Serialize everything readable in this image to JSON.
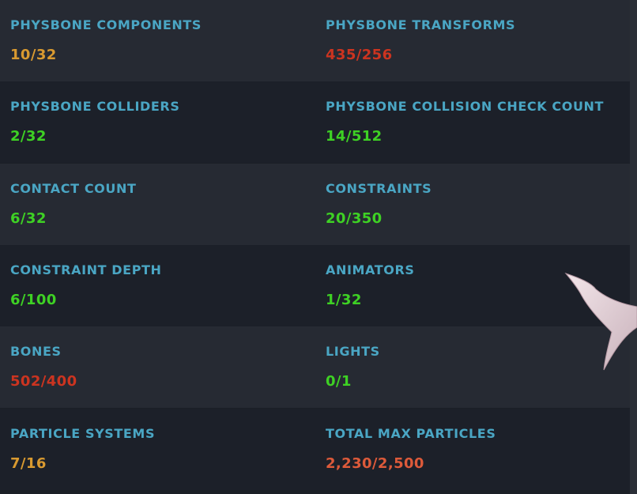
{
  "stats": [
    {
      "left": {
        "label": "PHYSBONE COMPONENTS",
        "value": "10/32",
        "rating": "warn"
      },
      "right": {
        "label": "PHYSBONE TRANSFORMS",
        "value": "435/256",
        "rating": "bad"
      }
    },
    {
      "left": {
        "label": "PHYSBONE COLLIDERS",
        "value": "2/32",
        "rating": "good"
      },
      "right": {
        "label": "PHYSBONE COLLISION CHECK COUNT",
        "value": "14/512",
        "rating": "good"
      }
    },
    {
      "left": {
        "label": "CONTACT COUNT",
        "value": "6/32",
        "rating": "good"
      },
      "right": {
        "label": "CONSTRAINTS",
        "value": "20/350",
        "rating": "good"
      }
    },
    {
      "left": {
        "label": "CONSTRAINT DEPTH",
        "value": "6/100",
        "rating": "good"
      },
      "right": {
        "label": "ANIMATORS",
        "value": "1/32",
        "rating": "good"
      }
    },
    {
      "left": {
        "label": "BONES",
        "value": "502/400",
        "rating": "bad"
      },
      "right": {
        "label": "LIGHTS",
        "value": "0/1",
        "rating": "good"
      }
    },
    {
      "left": {
        "label": "PARTICLE SYSTEMS",
        "value": "7/16",
        "rating": "warn"
      },
      "right": {
        "label": "TOTAL MAX PARTICLES",
        "value": "2,230/2,500",
        "rating": "poor"
      }
    }
  ],
  "colors": {
    "label": "#4aa6c4",
    "good": "#3ed124",
    "warn": "#d99a30",
    "bad": "#cc3420",
    "poor": "#dd5a3a"
  },
  "icons": {
    "cursor": "pointer-cursor-icon"
  }
}
